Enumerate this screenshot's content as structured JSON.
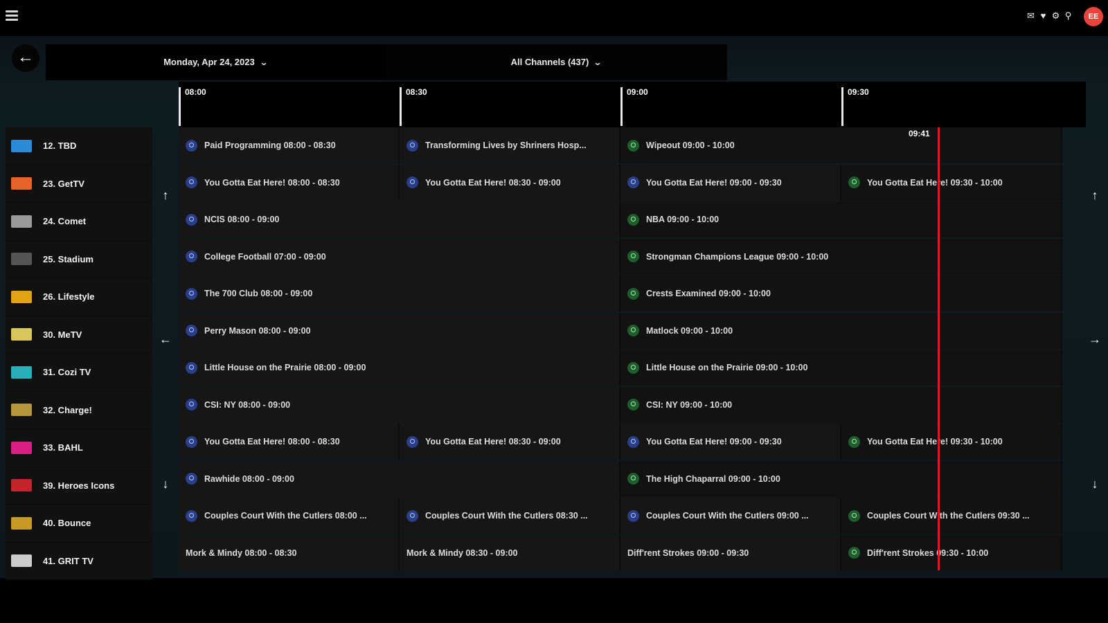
{
  "header": {
    "avatar_initials": "EE",
    "icons": [
      "mail-icon",
      "heart-icon",
      "settings-icon",
      "search-icon"
    ]
  },
  "filters": {
    "date": "Monday, Apr 24, 2023",
    "channels": "All Channels (437)"
  },
  "timeline": {
    "ticks": [
      "08:00",
      "08:30",
      "09:00",
      "09:30"
    ],
    "now": "09:41"
  },
  "channels": [
    {
      "name": "12. TBD",
      "logo_color": "#2a8bd8"
    },
    {
      "name": "23. GetTV",
      "logo_color": "#e8632b"
    },
    {
      "name": "24. Comet",
      "logo_color": "#9a9a9a"
    },
    {
      "name": "25. Stadium",
      "logo_color": "#555555"
    },
    {
      "name": "26. Lifestyle",
      "logo_color": "#e0a317"
    },
    {
      "name": "30. MeTV",
      "logo_color": "#d9c75a"
    },
    {
      "name": "31. Cozi TV",
      "logo_color": "#27b0b8"
    },
    {
      "name": "32. Charge!",
      "logo_color": "#b8963a"
    },
    {
      "name": "33. BAHL",
      "logo_color": "#d81f86"
    },
    {
      "name": "39. Heroes Icons",
      "logo_color": "#c0272d"
    },
    {
      "name": "40. Bounce",
      "logo_color": "#c79a25"
    },
    {
      "name": "41. GRIT TV",
      "logo_color": "#cccccc"
    }
  ],
  "schedule": [
    [
      {
        "title": "Paid Programming 08:00 - 08:30",
        "span": 1,
        "badge": "blue"
      },
      {
        "title": "Transforming Lives by Shriners Hosp...",
        "span": 1,
        "badge": "blue"
      },
      {
        "title": "Wipeout 09:00 - 10:00",
        "span": 2,
        "badge": "green"
      }
    ],
    [
      {
        "title": "You Gotta Eat Here! 08:00 - 08:30",
        "span": 1,
        "badge": "blue"
      },
      {
        "title": "You Gotta Eat Here! 08:30 - 09:00",
        "span": 1,
        "badge": "blue"
      },
      {
        "title": "You Gotta Eat Here! 09:00 - 09:30",
        "span": 1,
        "badge": "blue"
      },
      {
        "title": "You Gotta Eat Here! 09:30 - 10:00",
        "span": 1,
        "badge": "green"
      }
    ],
    [
      {
        "title": "NCIS 08:00 - 09:00",
        "span": 2,
        "badge": "blue"
      },
      {
        "title": "NBA 09:00 - 10:00",
        "span": 2,
        "badge": "green"
      }
    ],
    [
      {
        "title": "College Football 07:00 - 09:00",
        "span": 2,
        "badge": "blue"
      },
      {
        "title": "Strongman Champions League 09:00 - 10:00",
        "span": 2,
        "badge": "green"
      }
    ],
    [
      {
        "title": "The 700 Club 08:00 - 09:00",
        "span": 2,
        "badge": "blue"
      },
      {
        "title": "Crests Examined 09:00 - 10:00",
        "span": 2,
        "badge": "green"
      }
    ],
    [
      {
        "title": "Perry Mason 08:00 - 09:00",
        "span": 2,
        "badge": "blue"
      },
      {
        "title": "Matlock 09:00 - 10:00",
        "span": 2,
        "badge": "green"
      }
    ],
    [
      {
        "title": "Little House on the Prairie 08:00 - 09:00",
        "span": 2,
        "badge": "blue"
      },
      {
        "title": "Little House on the Prairie 09:00 - 10:00",
        "span": 2,
        "badge": "green"
      }
    ],
    [
      {
        "title": "CSI: NY 08:00 - 09:00",
        "span": 2,
        "badge": "blue"
      },
      {
        "title": "CSI: NY 09:00 - 10:00",
        "span": 2,
        "badge": "green"
      }
    ],
    [
      {
        "title": "You Gotta Eat Here! 08:00 - 08:30",
        "span": 1,
        "badge": "blue"
      },
      {
        "title": "You Gotta Eat Here! 08:30 - 09:00",
        "span": 1,
        "badge": "blue"
      },
      {
        "title": "You Gotta Eat Here! 09:00 - 09:30",
        "span": 1,
        "badge": "blue"
      },
      {
        "title": "You Gotta Eat Here! 09:30 - 10:00",
        "span": 1,
        "badge": "green"
      }
    ],
    [
      {
        "title": "Rawhide 08:00 - 09:00",
        "span": 2,
        "badge": "blue"
      },
      {
        "title": "The High Chaparral 09:00 - 10:00",
        "span": 2,
        "badge": "green"
      }
    ],
    [
      {
        "title": "Couples Court With the Cutlers 08:00 ...",
        "span": 1,
        "badge": "blue"
      },
      {
        "title": "Couples Court With the Cutlers 08:30 ...",
        "span": 1,
        "badge": "blue"
      },
      {
        "title": "Couples Court With the Cutlers 09:00 ...",
        "span": 1,
        "badge": "blue"
      },
      {
        "title": "Couples Court With the Cutlers 09:30 ...",
        "span": 1,
        "badge": "green"
      }
    ],
    [
      {
        "title": "Mork & Mindy 08:00 - 08:30",
        "span": 1,
        "badge": "none"
      },
      {
        "title": "Mork & Mindy 08:30 - 09:00",
        "span": 1,
        "badge": "none"
      },
      {
        "title": "Diff'rent Strokes 09:00 - 09:30",
        "span": 1,
        "badge": "none"
      },
      {
        "title": "Diff'rent Strokes 09:30 - 10:00",
        "span": 1,
        "badge": "green"
      }
    ]
  ]
}
